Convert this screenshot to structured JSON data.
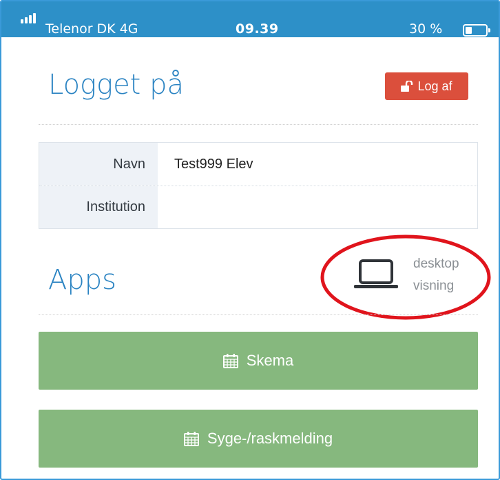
{
  "status_bar": {
    "carrier": "Telenor DK   4G",
    "time": "09.39",
    "battery_text": "30 %",
    "battery_level": 0.3
  },
  "header": {
    "title": "Logget på",
    "logout_label": "Log af",
    "logout_icon": "unlock-icon",
    "logout_color": "#db4f3c"
  },
  "profile": {
    "rows": [
      {
        "label": "Navn",
        "value": "Test999 Elev"
      },
      {
        "label": "Institution",
        "value": ""
      }
    ]
  },
  "apps": {
    "title": "Apps",
    "desktop_line1": "desktop",
    "desktop_line2": "visning",
    "desktop_icon": "laptop-icon",
    "buttons": [
      {
        "label": "Skema",
        "icon": "calendar-icon"
      },
      {
        "label": "Syge-/raskmelding",
        "icon": "calendar-icon"
      }
    ],
    "button_color": "#86b87e"
  },
  "theme": {
    "accent": "#2a83c2",
    "statusbar_bg": "#2d90c8",
    "annotation": "#e0141c"
  }
}
